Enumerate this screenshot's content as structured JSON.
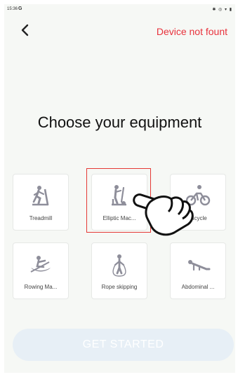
{
  "status_bar": {
    "time": "15:36",
    "carrier_icon": "G",
    "right_icons": "bluetooth-icon wifi-icon battery-icon"
  },
  "header": {
    "back_icon": "chevron-left-icon",
    "device_status": "Device not fount"
  },
  "title": "Choose your equipment",
  "equipment": [
    {
      "label": "Treadmill",
      "icon": "treadmill-icon"
    },
    {
      "label": "Elliptic Mac...",
      "icon": "elliptical-icon"
    },
    {
      "label": "Bicycle",
      "icon": "bicycle-icon"
    },
    {
      "label": "Rowing Ma...",
      "icon": "rowing-icon"
    },
    {
      "label": "Rope skipping",
      "icon": "rope-skipping-icon"
    },
    {
      "label": "Abdominal ...",
      "icon": "abdominal-icon"
    }
  ],
  "overlay": {
    "hand_icon": "pointing-hand-icon",
    "highlight_color": "#e53935"
  },
  "colors": {
    "accent_red": "#e8323c",
    "icon_gray": "#8e8e9a",
    "button_bg": "#e7eff6"
  },
  "start_button": {
    "label": "GET STARTED"
  }
}
